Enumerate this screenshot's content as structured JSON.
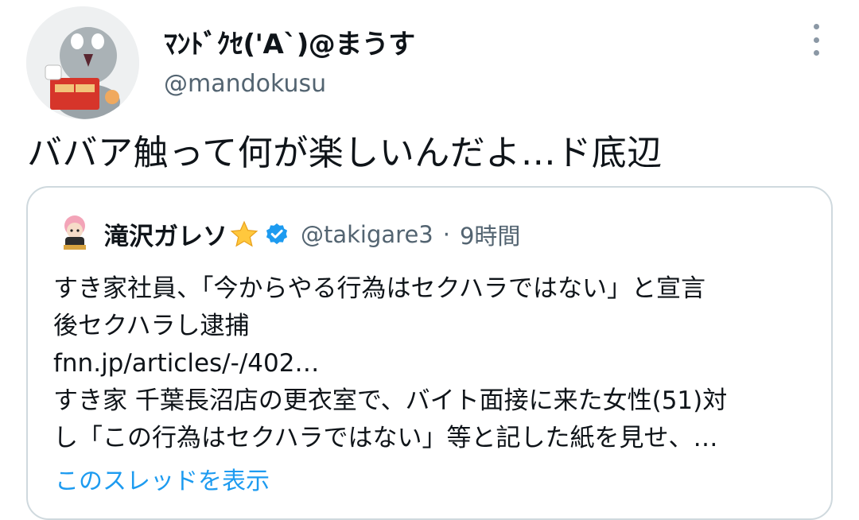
{
  "author": {
    "display_name": "ﾏﾝﾄﾞｸｾ('A`)@まうす",
    "handle": "@mandokusu"
  },
  "tweet": {
    "text": "ババア触って何が楽しいんだよ…ド底辺"
  },
  "quoted": {
    "display_name": "滝沢ガレソ",
    "handle": "@takigare3",
    "separator": "·",
    "time": "9時間",
    "lines": [
      "すき家社員、「今からやる行為はセクハラではない」と宣言",
      "後セクハラし逮捕",
      "fnn.jp/articles/-/402…",
      "すき家 千葉長沼店の更衣室で、バイト面接に来た女性(51)対",
      "し「この行為はセクハラではない」等と記した紙を見せ、…"
    ],
    "show_thread": "このスレッドを表示"
  },
  "colors": {
    "text": "#0f1419",
    "secondary": "#536471",
    "link": "#1d9bf0",
    "border": "#cfd9de",
    "verified": "#1d9bf0",
    "star": "#ffc83d"
  },
  "icons": [
    "avatar",
    "more-icon",
    "quoted-avatar",
    "star-icon",
    "verified-icon"
  ]
}
